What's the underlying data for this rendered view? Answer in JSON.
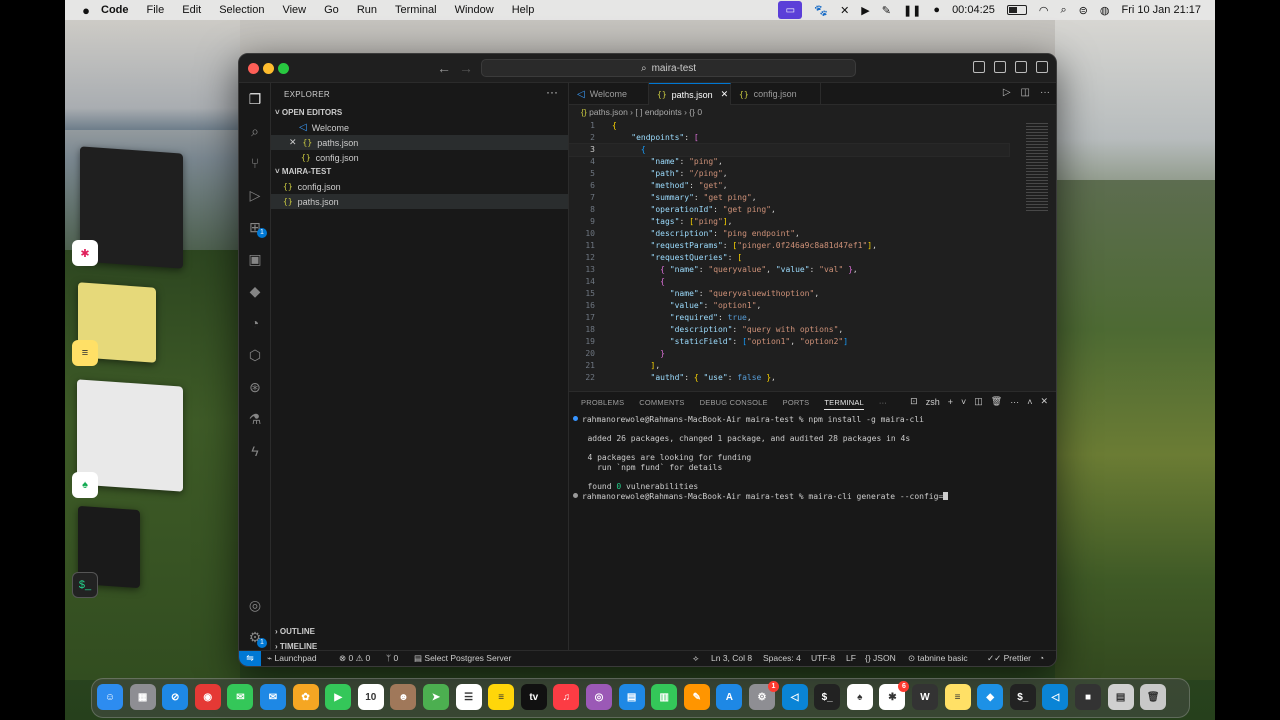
{
  "menubar": {
    "apple": "",
    "app": "Code",
    "menus": [
      "File",
      "Edit",
      "Selection",
      "View",
      "Go",
      "Run",
      "Terminal",
      "Window",
      "Help"
    ],
    "recording_time": "00:04:25",
    "datetime": "Fri 10 Jan  21:17"
  },
  "window": {
    "command_center": "maira-test",
    "sidebar": {
      "title": "EXPLORER",
      "more": "···",
      "open_editors_label": "OPEN EDITORS",
      "open_editors": [
        {
          "name": "Welcome",
          "icon": "vscode-icon"
        },
        {
          "name": "paths.json",
          "icon": "{}"
        },
        {
          "name": "config.json",
          "icon": "{}"
        }
      ],
      "folder_label": "MAIRA-TEST",
      "files": [
        {
          "name": "config.json",
          "icon": "{}"
        },
        {
          "name": "paths.json",
          "icon": "{}"
        }
      ],
      "outline_label": "OUTLINE",
      "timeline_label": "TIMELINE"
    },
    "tabs": [
      {
        "label": "Welcome"
      },
      {
        "label": "paths.json",
        "close": "✕"
      },
      {
        "label": "config.json"
      }
    ],
    "breadcrumb": {
      "file": "paths.json",
      "seg1": "endpoints",
      "seg2": "0"
    },
    "code_lines": [
      {
        "n": "1",
        "html": "<span class=\"p1\">{</span>"
      },
      {
        "n": "2",
        "html": "    <span class=\"k\">\"endpoints\"</span>: <span class=\"p2\">[</span>"
      },
      {
        "n": "3",
        "html": "      <span class=\"p3\">{</span>"
      },
      {
        "n": "4",
        "html": "        <span class=\"k\">\"name\"</span>: <span class=\"s\">\"ping\"</span>,"
      },
      {
        "n": "5",
        "html": "        <span class=\"k\">\"path\"</span>: <span class=\"s\">\"/ping\"</span>,"
      },
      {
        "n": "6",
        "html": "        <span class=\"k\">\"method\"</span>: <span class=\"s\">\"get\"</span>,"
      },
      {
        "n": "7",
        "html": "        <span class=\"k\">\"summary\"</span>: <span class=\"s\">\"get ping\"</span>,"
      },
      {
        "n": "8",
        "html": "        <span class=\"k\">\"operationId\"</span>: <span class=\"s\">\"get ping\"</span>,"
      },
      {
        "n": "9",
        "html": "        <span class=\"k\">\"tags\"</span>: <span class=\"p1\">[</span><span class=\"s\">\"ping\"</span><span class=\"p1\">]</span>,"
      },
      {
        "n": "10",
        "html": "        <span class=\"k\">\"description\"</span>: <span class=\"s\">\"ping endpoint\"</span>,"
      },
      {
        "n": "11",
        "html": "        <span class=\"k\">\"requestParams\"</span>: <span class=\"p1\">[</span><span class=\"s\">\"pinger.0f246a9c8a81d47ef1\"</span><span class=\"p1\">]</span>,"
      },
      {
        "n": "12",
        "html": "        <span class=\"k\">\"requestQueries\"</span>: <span class=\"p1\">[</span>"
      },
      {
        "n": "13",
        "html": "          <span class=\"p2\">{</span> <span class=\"k\">\"name\"</span>: <span class=\"s\">\"queryvalue\"</span>, <span class=\"k\">\"value\"</span>: <span class=\"s\">\"val\"</span> <span class=\"p2\">}</span>,"
      },
      {
        "n": "14",
        "html": "          <span class=\"p2\">{</span>"
      },
      {
        "n": "15",
        "html": "            <span class=\"k\">\"name\"</span>: <span class=\"s\">\"queryvaluewithoption\"</span>,"
      },
      {
        "n": "16",
        "html": "            <span class=\"k\">\"value\"</span>: <span class=\"s\">\"option1\"</span>,"
      },
      {
        "n": "17",
        "html": "            <span class=\"k\">\"required\"</span>: <span class=\"b\">true</span>,"
      },
      {
        "n": "18",
        "html": "            <span class=\"k\">\"description\"</span>: <span class=\"s\">\"query with options\"</span>,"
      },
      {
        "n": "19",
        "html": "            <span class=\"k\">\"staticField\"</span>: <span class=\"p3\">[</span><span class=\"s\">\"option1\"</span>, <span class=\"s\">\"option2\"</span><span class=\"p3\">]</span>"
      },
      {
        "n": "20",
        "html": "          <span class=\"p2\">}</span>"
      },
      {
        "n": "21",
        "html": "        <span class=\"p1\">]</span>,"
      },
      {
        "n": "22",
        "html": "        <span class=\"k\">\"authd\"</span>: <span class=\"p1\">{</span> <span class=\"k\">\"use\"</span>: <span class=\"b\">false</span> <span class=\"p1\">}</span>,"
      }
    ],
    "panel": {
      "tabs": [
        "PROBLEMS",
        "COMMENTS",
        "DEBUG CONSOLE",
        "PORTS",
        "TERMINAL",
        "···"
      ],
      "active_tab": "TERMINAL",
      "shell": "zsh",
      "terminal_lines": [
        {
          "dot": "blue",
          "text": "rahmanorewole@Rahmans-MacBook-Air maira-test % npm install -g maira-cli"
        },
        {
          "dot": "",
          "text": ""
        },
        {
          "dot": "",
          "text": "added 26 packages, changed 1 package, and audited 28 packages in 4s"
        },
        {
          "dot": "",
          "text": ""
        },
        {
          "dot": "",
          "text": "4 packages are looking for funding"
        },
        {
          "dot": "",
          "text": "  run `npm fund` for details"
        },
        {
          "dot": "",
          "text": ""
        },
        {
          "dot": "",
          "text": "found ",
          "highlight": "0",
          "after": " vulnerabilities"
        },
        {
          "dot": "gray",
          "text": "rahmanorewole@Rahmans-MacBook-Air maira-test % maira-cli generate --config=",
          "caret": true
        }
      ]
    },
    "status": {
      "remote": "⇋",
      "launchpad": "Launchpad",
      "problems": "⊗ 0 ⚠ 0",
      "ports": "ᛘ 0",
      "postgres": "Select Postgres Server",
      "cursor": "Ln 3, Col 8",
      "spaces": "Spaces: 4",
      "encoding": "UTF-8",
      "eol": "LF",
      "language": "{} JSON",
      "tabnine": "⊙ tabnine basic",
      "prettier": "✓✓ Prettier"
    }
  },
  "dock": {
    "apps": [
      {
        "name": "finder",
        "color": "#2d8cf0",
        "glyph": "☺"
      },
      {
        "name": "launchpad",
        "color": "#8e8e93",
        "glyph": "▦"
      },
      {
        "name": "safari",
        "color": "#1e88e5",
        "glyph": "⊘"
      },
      {
        "name": "chrome",
        "color": "#e53935",
        "glyph": "◉"
      },
      {
        "name": "messages",
        "color": "#34c759",
        "glyph": "✉"
      },
      {
        "name": "mail",
        "color": "#1e88e5",
        "glyph": "✉"
      },
      {
        "name": "photos",
        "color": "#f5a623",
        "glyph": "✿"
      },
      {
        "name": "facetime",
        "color": "#34c759",
        "glyph": "▶"
      },
      {
        "name": "calendar",
        "color": "#ffffff",
        "glyph": "10"
      },
      {
        "name": "contacts",
        "color": "#a0785a",
        "glyph": "☻"
      },
      {
        "name": "maps",
        "color": "#4caf50",
        "glyph": "➤"
      },
      {
        "name": "reminders",
        "color": "#ffffff",
        "glyph": "☰"
      },
      {
        "name": "notes",
        "color": "#ffd60a",
        "glyph": "≡"
      },
      {
        "name": "tv",
        "color": "#111111",
        "glyph": "tv"
      },
      {
        "name": "music",
        "color": "#fc3c44",
        "glyph": "♫"
      },
      {
        "name": "podcasts",
        "color": "#9b59b6",
        "glyph": "◎"
      },
      {
        "name": "keynote",
        "color": "#1e88e5",
        "glyph": "▤"
      },
      {
        "name": "numbers",
        "color": "#34c759",
        "glyph": "▥"
      },
      {
        "name": "pages",
        "color": "#ff9500",
        "glyph": "✎"
      },
      {
        "name": "app-store",
        "color": "#1e88e5",
        "glyph": "A"
      },
      {
        "name": "system-settings",
        "color": "#8e8e93",
        "glyph": "⚙",
        "badge": "1"
      },
      {
        "name": "vscode",
        "color": "#0a84d6",
        "glyph": "◁"
      },
      {
        "name": "terminal",
        "color": "#222222",
        "glyph": "$_"
      },
      {
        "name": "mongodb-compass",
        "color": "#ffffff",
        "glyph": "♠"
      },
      {
        "name": "slack",
        "color": "#ffffff",
        "glyph": "✱",
        "badge": "6"
      },
      {
        "name": "webstorm",
        "color": "#333333",
        "glyph": "W"
      },
      {
        "name": "stickies",
        "color": "#ffe066",
        "glyph": "≡"
      },
      {
        "name": "docker",
        "color": "#1d91e6",
        "glyph": "◆"
      },
      {
        "name": "terminal-2",
        "color": "#222222",
        "glyph": "$_"
      },
      {
        "name": "vscode-2",
        "color": "#0a84d6",
        "glyph": "◁"
      },
      {
        "name": "screen-recorder",
        "color": "#333333",
        "glyph": "■"
      },
      {
        "name": "downloads",
        "color": "#d0d0d0",
        "glyph": "▤"
      },
      {
        "name": "trash",
        "color": "#c8c8c8",
        "glyph": "🗑"
      }
    ]
  }
}
